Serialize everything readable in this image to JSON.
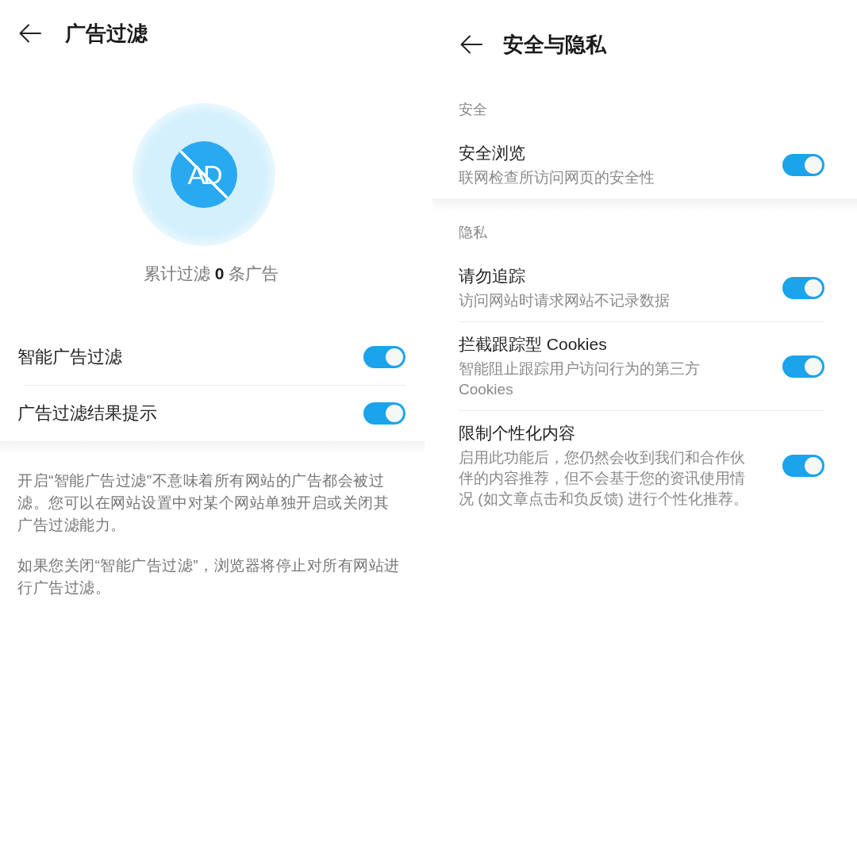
{
  "ad_filter_page": {
    "header": {
      "title": "广告过滤"
    },
    "emblem": {
      "text": "AD"
    },
    "counter": "累计过滤 **0** 条广告",
    "settings": [
      {
        "label": "智能广告过滤",
        "on": true
      },
      {
        "label": "广告过滤结果提示",
        "on": true
      }
    ],
    "notes": [
      "开启“智能广告过滤”不意味着所有网站的广告都会被过滤。您可以在网站设置中对某个网站单独开启或关闭其广告过滤能力。",
      "如果您关闭“智能广告过滤”，浏览器将停止对所有网站进行广告过滤。"
    ]
  },
  "privacy_page": {
    "header": {
      "title": "安全与隐私"
    },
    "sections": [
      {
        "heading": "安全",
        "settings": [
          {
            "label": "安全浏览",
            "description": "联网检查所访问网页的安全性",
            "on": true
          }
        ]
      },
      {
        "heading": "隐私",
        "settings": [
          {
            "label": "请勿追踪",
            "description": "访问网站时请求网站不记录数据",
            "on": true
          },
          {
            "label": "拦截跟踪型 Cookies",
            "description": "智能阻止跟踪用户访问行为的第三方 Cookies",
            "on": true
          },
          {
            "label": "限制个性化内容",
            "description": "启用此功能后，您仍然会收到我们和合作伙伴的内容推荐，但不会基于您的资讯使用情况 (如文章点击和负反馈) 进行个性化推荐。",
            "on": true
          }
        ]
      }
    ]
  }
}
